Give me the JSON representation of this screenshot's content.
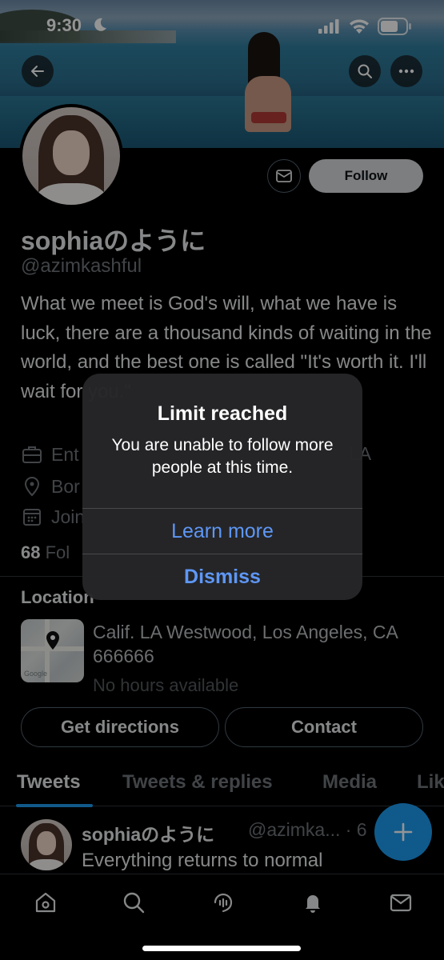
{
  "status_bar": {
    "time": "9:30"
  },
  "profile": {
    "name": "sophiaのように",
    "handle": "@azimkashful",
    "bio": "What we meet is God's will, what we have is luck, there are a thousand kinds of waiting in the world, and the best one is called \"It's worth it. I'll wait for you.\"",
    "follow_label": "Follow",
    "meta": {
      "category_partial": "Ent",
      "category_right_partial": "LA",
      "born_partial": "Bor",
      "joined_partial": "Join"
    },
    "following_count": "68",
    "following_label_partial": "Fol"
  },
  "location": {
    "title": "Location",
    "address": "Calif. LA Westwood, Los Angeles, CA 666666",
    "hours": "No hours available",
    "map_label": "Google",
    "directions_label": "Get directions",
    "contact_label": "Contact"
  },
  "tabs": [
    "Tweets",
    "Tweets & replies",
    "Media",
    "Lik"
  ],
  "tweet": {
    "name": "sophiaのように",
    "handle": "@azimka... · 6",
    "text": "Everything returns to normal"
  },
  "alert": {
    "title": "Limit reached",
    "message": "You are unable to follow more people at this time.",
    "learn_more": "Learn more",
    "dismiss": "Dismiss"
  },
  "colors": {
    "accent": "#1d9bf0",
    "alert_link": "#5e97f6",
    "background": "#000000",
    "secondary_text": "#71767b"
  },
  "icons": [
    "back-icon",
    "search-icon",
    "more-icon",
    "mail-icon",
    "briefcase-icon",
    "location-pin-icon",
    "calendar-icon",
    "compose-icon",
    "home-icon",
    "spaces-icon",
    "bell-icon"
  ]
}
